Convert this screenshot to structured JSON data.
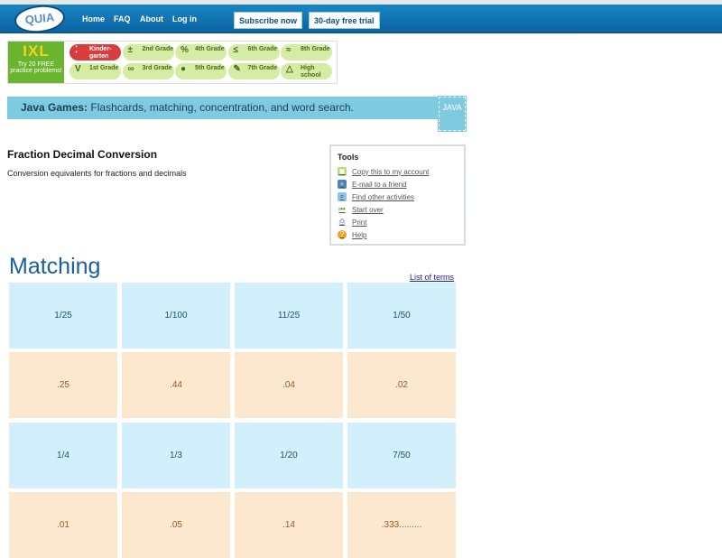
{
  "header": {
    "logo": "QUIA",
    "nav": [
      "Home",
      "FAQ",
      "About",
      "Log in"
    ],
    "subscribe": "Subscribe now",
    "trial": "30-day free trial"
  },
  "ixl": {
    "logo": "IXL",
    "promo": "Try 20 FREE practice problems!",
    "grades": [
      {
        "label": "Kinder-garten",
        "icon": "dots"
      },
      {
        "label": "2nd Grade",
        "icon": "±"
      },
      {
        "label": "4th Grade",
        "icon": "%"
      },
      {
        "label": "6th Grade",
        "icon": "≤"
      },
      {
        "label": "8th Grade",
        "icon": "≈"
      },
      {
        "label": "1st Grade",
        "icon": "V"
      },
      {
        "label": "3rd Grade",
        "icon": "∞"
      },
      {
        "label": "5th Grade",
        "icon": "apple"
      },
      {
        "label": "7th Grade",
        "icon": "pencil"
      },
      {
        "label": "High school",
        "icon": "△"
      }
    ]
  },
  "java": {
    "bold": "Java Games:",
    "text": " Flashcards, matching, concentration, and word search.",
    "icon": "JAVA"
  },
  "page": {
    "title": "Fraction Decimal Conversion",
    "description": "Conversion equivalents for fractions and decimals"
  },
  "tools": {
    "heading": "Tools",
    "items": [
      "Copy this to my account",
      "E-mail to a friend",
      "Find other activities",
      "Start over",
      "Print",
      "Help"
    ]
  },
  "game": {
    "heading": "Matching",
    "list_link": "List of terms",
    "rows": [
      {
        "type": "q",
        "cells": [
          "1/25",
          "1/100",
          "11/25",
          "1/50"
        ]
      },
      {
        "type": "a",
        "cells": [
          ".25",
          ".44",
          ".04",
          ".02"
        ]
      },
      {
        "type": "q",
        "cells": [
          "1/4",
          "1/3",
          "1/20",
          "7/50"
        ]
      },
      {
        "type": "a",
        "cells": [
          ".01",
          ".05",
          ".14",
          ".333........."
        ]
      }
    ]
  }
}
